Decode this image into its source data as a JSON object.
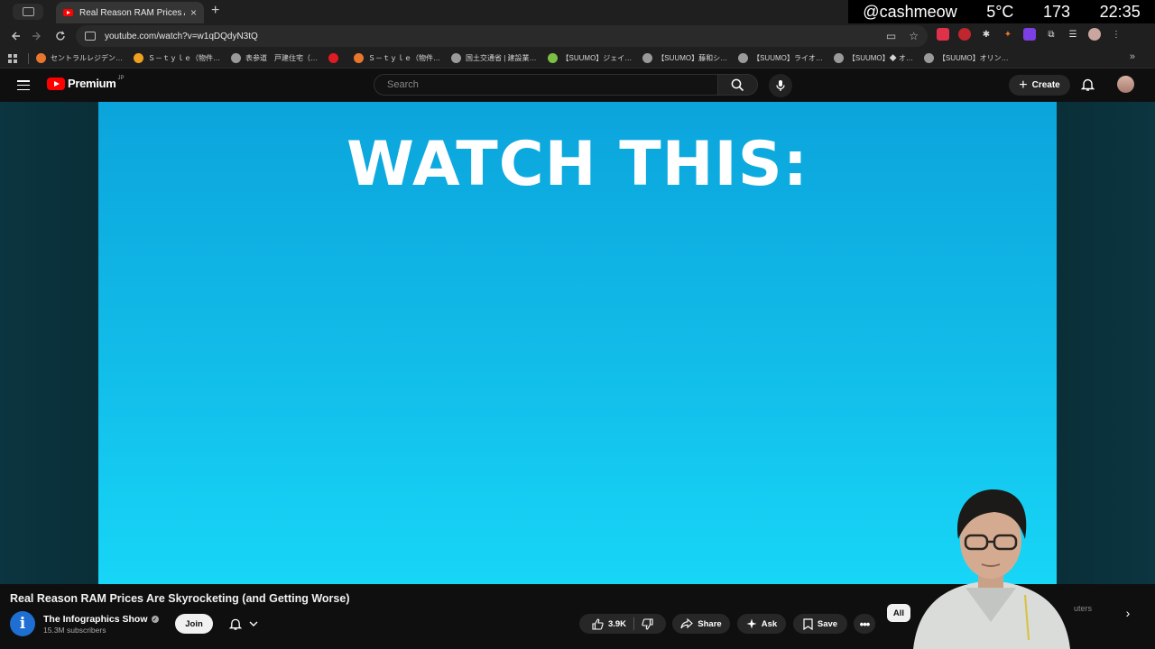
{
  "browser": {
    "tab_title": "Real Reason RAM Prices Are",
    "tab_close": "×",
    "new_tab": "+",
    "url": "youtube.com/watch?v=w1qDQdyN3tQ",
    "overlay": {
      "handle": "@cashmeow",
      "temperature": "5°C",
      "count": "173",
      "time": "22:35"
    },
    "bookmarks": [
      {
        "label": "セントラルレジデン…",
        "color": "#e8762d"
      },
      {
        "label": "Ｓ－ｔｙｌｅ（物件…",
        "color": "#f0a020"
      },
      {
        "label": "表参道　戸建住宅（…",
        "color": "#9a9a9a"
      },
      {
        "label": "",
        "color": "#e01b24"
      },
      {
        "label": "Ｓ－ｔｙｌｅ（物件…",
        "color": "#e8762d"
      },
      {
        "label": "国土交通省 | 建設業…",
        "color": "#9a9a9a"
      },
      {
        "label": "【SUUMO】ジェイ…",
        "color": "#7bc043"
      },
      {
        "label": "【SUUMO】藤和シ…",
        "color": "#9a9a9a"
      },
      {
        "label": "【SUUMO】ライオ…",
        "color": "#9a9a9a"
      },
      {
        "label": "【SUUMO】◆ オ…",
        "color": "#9a9a9a"
      },
      {
        "label": "【SUUMO】オリン…",
        "color": "#9a9a9a"
      }
    ],
    "bookmarks_more": "»"
  },
  "youtube": {
    "logo_text": "Premium",
    "logo_region": "JP",
    "search_placeholder": "Search",
    "create_label": "Create"
  },
  "video": {
    "frame_text": "WATCH THIS:",
    "title": "Real Reason RAM Prices Are Skyrocketing (and Getting Worse)",
    "channel_initial": "i",
    "channel_name": "The Infographics Show",
    "verified_mark": "✓",
    "subscribers": "15.3M subscribers",
    "join_label": "Join",
    "like_count": "3.9K",
    "share_label": "Share",
    "ask_label": "Ask",
    "save_label": "Save",
    "chip_all": "All",
    "chip_partial": "uters",
    "chip_next": "›"
  },
  "colors": {
    "youtube_red": "#ff0000",
    "video_blue_top": "#0ba4dc",
    "video_blue_bottom": "#17d6f7"
  }
}
